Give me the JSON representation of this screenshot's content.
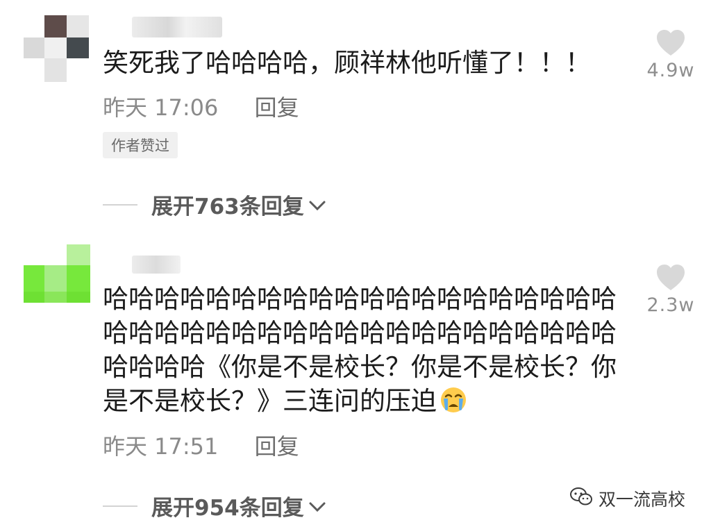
{
  "comments": [
    {
      "text": "笑死我了哈哈哈哈，顾祥林他听懂了！！！",
      "time": "昨天 17:06",
      "reply_label": "回复",
      "badge": "作者赞过",
      "likes": "4.9w",
      "expand_label": "展开763条回复",
      "avatar_colors": [
        "#ffffff",
        "#5e4c4a",
        "#e6e6e6",
        "#d9d9d9",
        "#f0f0f0",
        "#444a4e",
        "#e3e3e3",
        "#f7f7f7"
      ]
    },
    {
      "text_main": "哈哈哈哈哈哈哈哈哈哈哈哈哈哈哈哈哈哈哈哈哈哈哈哈哈哈哈哈哈哈哈哈哈哈哈哈哈哈哈哈哈哈哈哈《你是不是校长？你是不是校长？你是不是校长？》三连问的压迫",
      "time": "昨天 17:51",
      "reply_label": "回复",
      "likes": "2.3w",
      "expand_label": "展开954条回复",
      "avatar_colors": [
        "#77e83c",
        "#6ee033",
        "#a6ec86",
        "#79e240",
        "#66e02d"
      ]
    }
  ],
  "emoji": "crying-face",
  "watermark": {
    "text": "双一流高校"
  },
  "colors": {
    "text": "#1b1b1b",
    "meta": "#8a8a8a",
    "like_heart": "#d8d8d8",
    "badge_bg": "#f0f0f0",
    "avatar_green": "#77e83c"
  }
}
